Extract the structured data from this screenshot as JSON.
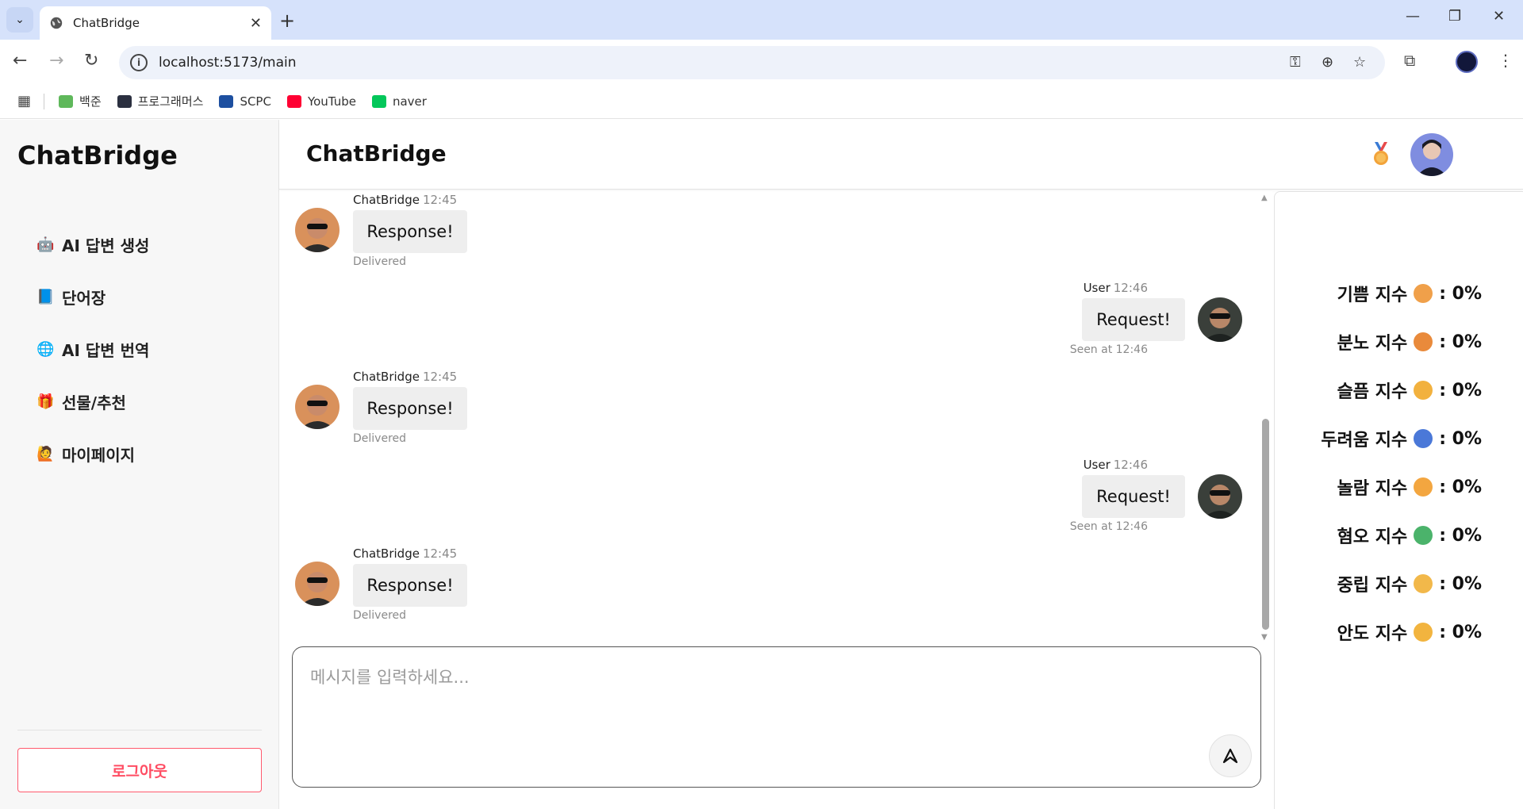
{
  "browser": {
    "tab_title": "ChatBridge",
    "url": "localhost:5173/main",
    "bookmarks": [
      {
        "label": "백준",
        "color": "#5fb85b"
      },
      {
        "label": "프로그래머스",
        "color": "#2b3040"
      },
      {
        "label": "SCPC",
        "color": "#1d4fa0"
      },
      {
        "label": "YouTube",
        "color": "#ff0033"
      },
      {
        "label": "naver",
        "color": "#03c75a"
      }
    ]
  },
  "sidebar": {
    "brand": "ChatBridge",
    "items": [
      {
        "icon": "robot-icon",
        "emoji": "🤖",
        "label": "AI 답변 생성"
      },
      {
        "icon": "book-icon",
        "emoji": "📘",
        "label": "단어장"
      },
      {
        "icon": "globe-icon",
        "emoji": "🌐",
        "label": "AI 답변 번역"
      },
      {
        "icon": "gift-icon",
        "emoji": "🎁",
        "label": "선물/추천"
      },
      {
        "icon": "person-raising-hand-icon",
        "emoji": "🙋",
        "label": "마이페이지"
      }
    ],
    "logout_label": "로그아웃"
  },
  "header": {
    "title": "ChatBridge"
  },
  "messages": [
    {
      "sender": "ChatBridge",
      "time": "12:45",
      "text": "Response!",
      "status": "Delivered",
      "side": "left"
    },
    {
      "sender": "User",
      "time": "12:46",
      "text": "Request!",
      "status": "Seen at 12:46",
      "side": "right"
    },
    {
      "sender": "ChatBridge",
      "time": "12:45",
      "text": "Response!",
      "status": "Delivered",
      "side": "left"
    },
    {
      "sender": "User",
      "time": "12:46",
      "text": "Request!",
      "status": "Seen at 12:46",
      "side": "right"
    },
    {
      "sender": "ChatBridge",
      "time": "12:45",
      "text": "Response!",
      "status": "Delivered",
      "side": "left"
    }
  ],
  "composer": {
    "placeholder": "메시지를 입력하세요..."
  },
  "emotions": [
    {
      "label": "기쁨 지수",
      "value": ": 0%",
      "color": "#f0a04a"
    },
    {
      "label": "분노 지수",
      "value": ": 0%",
      "color": "#e98a3b"
    },
    {
      "label": "슬픔 지수",
      "value": ": 0%",
      "color": "#f2b13e"
    },
    {
      "label": "두려움 지수",
      "value": ": 0%",
      "color": "#4a78d8"
    },
    {
      "label": "놀람 지수",
      "value": ": 0%",
      "color": "#f3a640"
    },
    {
      "label": "혐오 지수",
      "value": ": 0%",
      "color": "#4bb36b"
    },
    {
      "label": "중립 지수",
      "value": ": 0%",
      "color": "#f2b84a"
    },
    {
      "label": "안도 지수",
      "value": ": 0%",
      "color": "#f2b43f"
    }
  ]
}
